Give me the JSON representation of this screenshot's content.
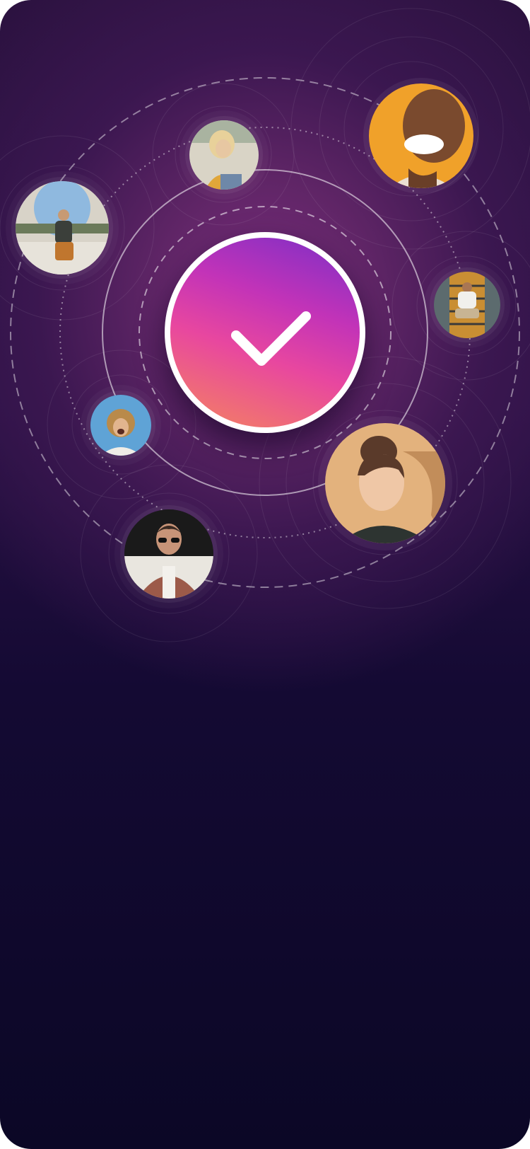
{
  "screen": {
    "background_top": "#2c1240",
    "background_bottom": "#0b0726",
    "glow_color": "#7a2d7c"
  },
  "center_badge": {
    "icon": "checkmark-icon",
    "gradient_colors": [
      "#7b2fc6",
      "#c233b8",
      "#e8479f",
      "#f4855e"
    ],
    "ring_color": "#ffffff"
  },
  "avatars": [
    {
      "name": "avatar-bald-woman-laughing",
      "bg": "#f0a12a",
      "skin": "#7a4a2e",
      "cloth": "#eadfd2"
    },
    {
      "name": "avatar-blonde-woman-beach",
      "bg": "#d9d4c6",
      "skin": "#e7c7a2",
      "cloth": "#e0a63a"
    },
    {
      "name": "avatar-man-sitting-wall",
      "bg": "#d8d3c8",
      "skin": "#c79a73",
      "cloth": "#3b3f3a"
    },
    {
      "name": "avatar-man-stairs",
      "bg": "#5c6b6e",
      "skin": "#a97653",
      "cloth": "#f1f0ec"
    },
    {
      "name": "avatar-curly-woman-laughing",
      "bg": "#5fa3d6",
      "skin": "#e2b58e",
      "cloth": "#f0ede7"
    },
    {
      "name": "avatar-woman-sunlit",
      "bg": "#e3b27d",
      "skin": "#efc7a6",
      "cloth": "#2d3431"
    },
    {
      "name": "avatar-man-sunglasses",
      "bg": "#1a1a1a",
      "skin": "#c79478",
      "cloth": "#9c5a49"
    }
  ]
}
